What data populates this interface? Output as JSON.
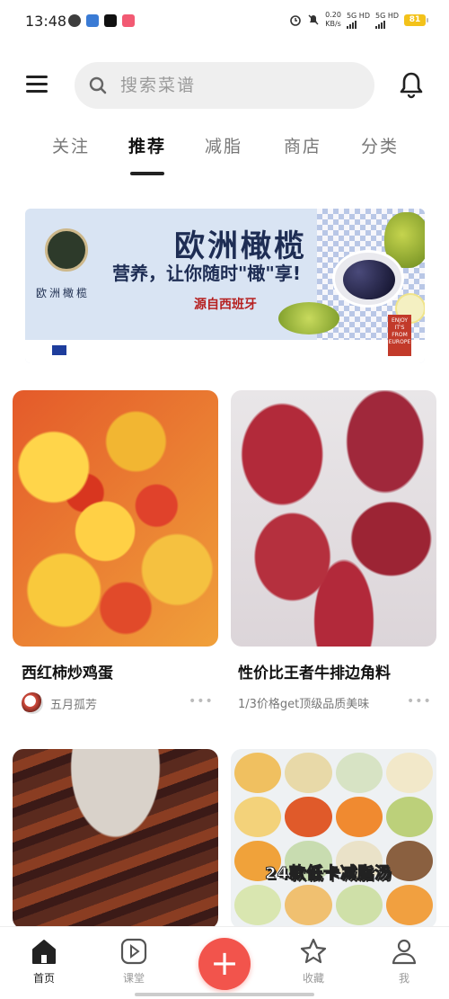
{
  "status_bar": {
    "time": "13:48",
    "net_speed_value": "0.20",
    "net_speed_unit": "KB/s",
    "sim1": "5G HD",
    "sim2": "5G HD",
    "battery": "81"
  },
  "header": {
    "search_placeholder": "搜索菜谱"
  },
  "tabs": [
    {
      "label": "关注",
      "active": false
    },
    {
      "label": "推荐",
      "active": true
    },
    {
      "label": "减脂",
      "active": false
    },
    {
      "label": "商店",
      "active": false
    },
    {
      "label": "分类",
      "active": false
    }
  ],
  "banner": {
    "logo_text": "欧洲橄榄",
    "title": "欧洲橄榄",
    "subtitle": "营养，让你随时\"橄\"享!",
    "origin": "源自西班牙",
    "enjoy_badge": "ENJOY IT'S FROM EUROPE"
  },
  "feed": [
    {
      "title": "西红柿炒鸡蛋",
      "author": "五月孤芳"
    },
    {
      "title": "性价比王者牛排边角料",
      "author": "1/3价格get顶级品质美味"
    },
    {
      "title": "",
      "author": ""
    },
    {
      "title": "",
      "author": "",
      "image_text": "24款低卡减脂汤"
    }
  ],
  "bottom_nav": [
    {
      "label": "首页",
      "icon": "home-icon",
      "active": true
    },
    {
      "label": "课堂",
      "icon": "play-icon",
      "active": false
    },
    {
      "label": "+",
      "icon": "add-icon",
      "active": false
    },
    {
      "label": "收藏",
      "icon": "star-icon",
      "active": false
    },
    {
      "label": "我",
      "icon": "profile-icon",
      "active": false
    }
  ],
  "colors": {
    "accent": "#f2544c",
    "text_primary": "#111111",
    "text_secondary": "#777777",
    "search_bg": "#efefef",
    "battery": "#f3c21a"
  }
}
